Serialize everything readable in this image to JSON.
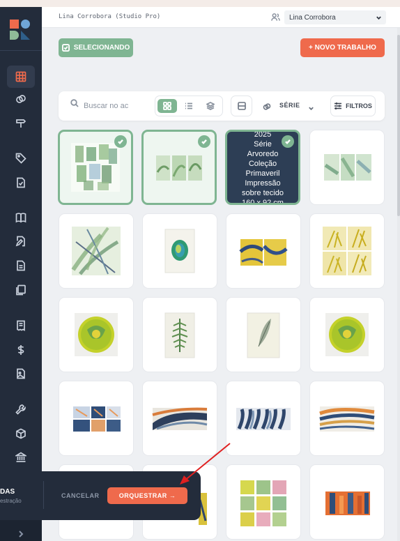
{
  "header": {
    "studio_name": "Lina Corrobora (Studio Pro)",
    "user_name": "Lina Corrobora"
  },
  "actions": {
    "selecting_label": "SELECIONANDO",
    "new_job_label": "+ NOVO TRABALHO"
  },
  "toolbar": {
    "search_placeholder": "Buscar no ac",
    "series_label": "SÉRIE",
    "filters_label": "FILTROS"
  },
  "sidebar": {
    "items": [
      "grid-icon",
      "link-icon",
      "signpost-icon",
      "tag-icon",
      "document-check-icon",
      "book-icon",
      "file-pen-icon",
      "file-text-icon",
      "files-icon",
      "receipt-icon",
      "dollar-icon",
      "image-file-icon",
      "wrench-icon",
      "box-icon",
      "bank-icon"
    ]
  },
  "grid": {
    "overlay_card_text": "2025\nSérie Arvoredo\nColeção Primaveril\nImpressão sobre tecido\n160 x 92 cm",
    "overlay_lines": [
      "2025",
      "Série",
      "Arvoredo",
      "Coleção",
      "Primaveril",
      "Impressão",
      "sobre tecido",
      "160 x 92 cm"
    ],
    "selected_cards": [
      0,
      1,
      2
    ],
    "card_count": 20
  },
  "bottom_bar": {
    "title": "DAS",
    "subtitle": "estração",
    "cancel_label": "CANCELAR",
    "orchestrate_label": "ORQUESTRAR →"
  },
  "colors": {
    "accent": "#ef6a4c",
    "selected_green": "#7fb592",
    "sidebar": "#232c3b"
  }
}
